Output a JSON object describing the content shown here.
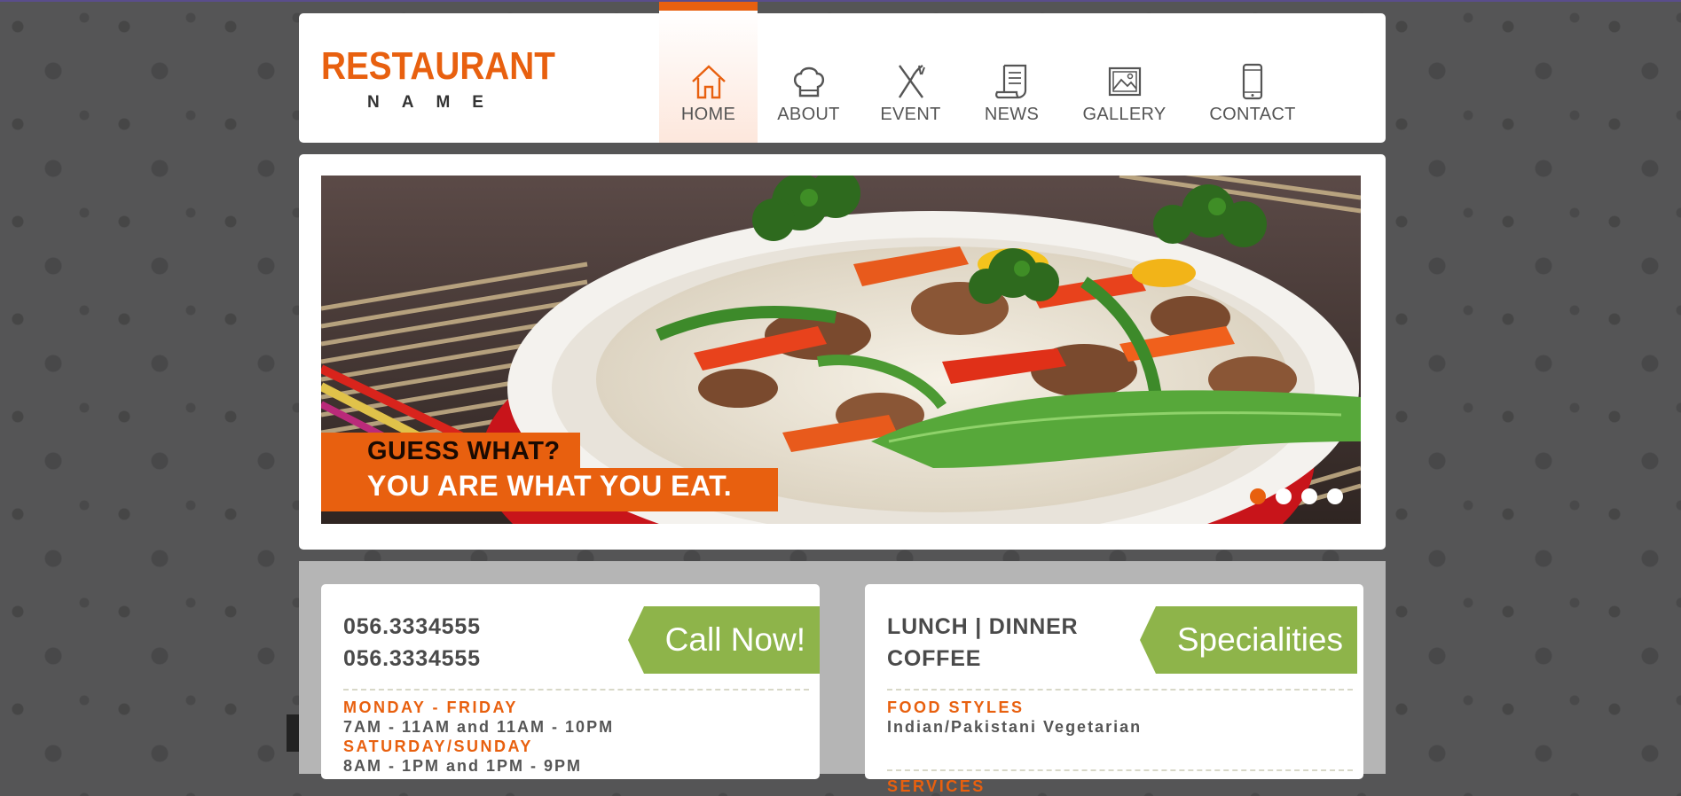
{
  "header": {
    "logo_main": "RESTAURANT",
    "logo_sub": "NAME",
    "nav": [
      {
        "label": "HOME",
        "icon": "home-icon",
        "active": true
      },
      {
        "label": "ABOUT",
        "icon": "chef-hat-icon",
        "active": false
      },
      {
        "label": "EVENT",
        "icon": "fork-knife-icon",
        "active": false
      },
      {
        "label": "NEWS",
        "icon": "scroll-icon",
        "active": false
      },
      {
        "label": "GALLERY",
        "icon": "picture-icon",
        "active": false
      },
      {
        "label": "CONTACT",
        "icon": "phone-icon",
        "active": false
      }
    ]
  },
  "slider": {
    "caption_line1": "GUESS WHAT?",
    "caption_line2": "YOU ARE WHAT YOU EAT.",
    "dots_count": 4,
    "active_dot": 1
  },
  "contact_card": {
    "phone1": "056.3334555",
    "phone2": "056.3334555",
    "ribbon": "Call Now!",
    "weekday_label": "MONDAY - FRIDAY",
    "weekday_hours": "7AM - 11AM and 11AM - 10PM",
    "weekend_label": "SATURDAY/SUNDAY",
    "weekend_hours": "8AM - 1PM and 1PM - 9PM"
  },
  "specialities_card": {
    "line1": "LUNCH | DINNER",
    "line2": "COFFEE",
    "ribbon": "Specialities",
    "food_label": "FOOD STYLES",
    "food_value": "Indian/Pakistani Vegetarian",
    "services_label": "SERVICES"
  },
  "colors": {
    "accent": "#e8600f",
    "ribbon_green": "#8eb44a",
    "background": "#555556"
  }
}
